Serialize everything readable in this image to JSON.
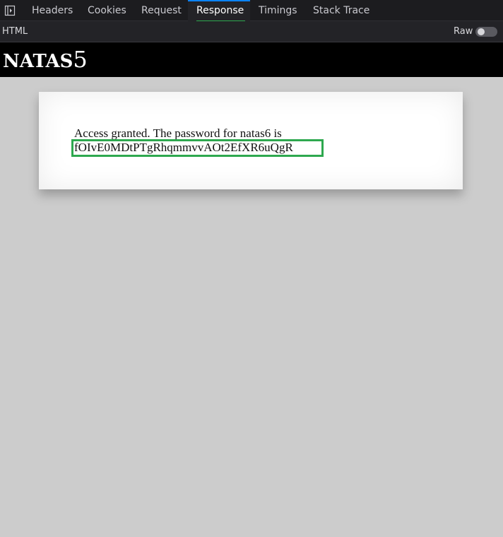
{
  "devtools": {
    "tabs": [
      {
        "label": "Headers",
        "active": false
      },
      {
        "label": "Cookies",
        "active": false
      },
      {
        "label": "Request",
        "active": false
      },
      {
        "label": "Response",
        "active": true
      },
      {
        "label": "Timings",
        "active": false
      },
      {
        "label": "Stack Trace",
        "active": false
      }
    ],
    "subbar": {
      "format_label": "HTML",
      "raw_label": "Raw",
      "raw_enabled": false
    },
    "colors": {
      "active_tab_indicator": "#0a84ff",
      "highlight": "#2ea84f"
    }
  },
  "page": {
    "title_letters": "NATAS",
    "title_number": "5",
    "message": "Access granted. The password for natas6 is",
    "password": "fOIvE0MDtPTgRhqmmvvAOt2EfXR6uQgR"
  }
}
